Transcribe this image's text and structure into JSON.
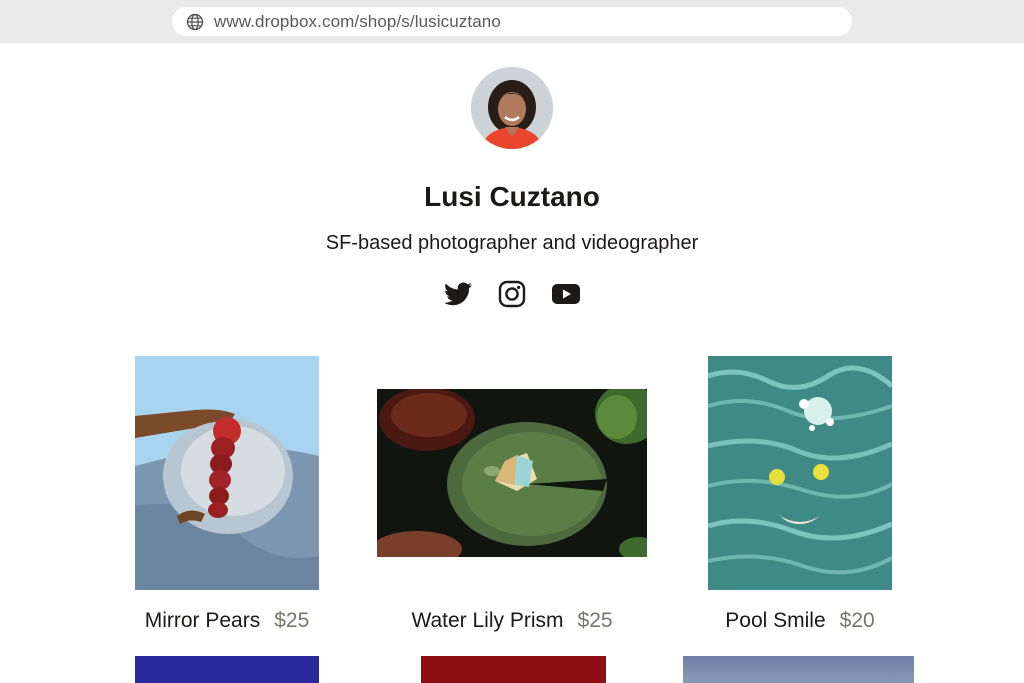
{
  "browser": {
    "url": "www.dropbox.com/shop/s/lusicuztano",
    "icon": "globe-icon"
  },
  "profile": {
    "name": "Lusi Cuztano",
    "bio": "SF-based photographer and videographer",
    "social": [
      {
        "icon": "twitter-icon"
      },
      {
        "icon": "instagram-icon"
      },
      {
        "icon": "youtube-icon"
      }
    ]
  },
  "products": [
    {
      "title": "Mirror Pears",
      "price": "$25"
    },
    {
      "title": "Water Lily Prism",
      "price": "$25"
    },
    {
      "title": "Pool Smile",
      "price": "$20"
    }
  ],
  "colors": {
    "text": "#1e1919",
    "price": "#7a746e",
    "browser_chrome": "#e9e9e9"
  }
}
